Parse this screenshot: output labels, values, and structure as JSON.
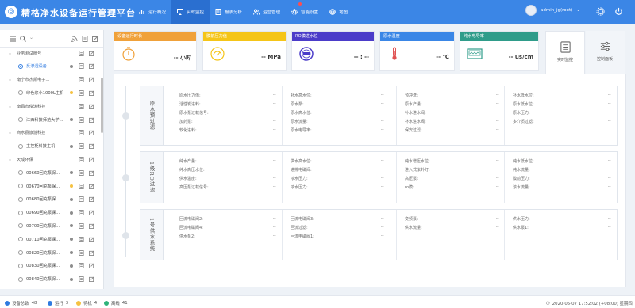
{
  "header": {
    "title": "精格净水设备运行管理平台",
    "nav": [
      {
        "label": "运行概况",
        "icon": "bar-chart-icon"
      },
      {
        "label": "实时监控",
        "icon": "monitor-icon",
        "active": true
      },
      {
        "label": "报表分析",
        "icon": "report-icon"
      },
      {
        "label": "运营管理",
        "icon": "users-icon"
      },
      {
        "label": "智能设置",
        "icon": "gear-icon",
        "badge": true
      },
      {
        "label": "地图",
        "icon": "globe-icon"
      }
    ],
    "user": "admin_jg(root)"
  },
  "sidebar": {
    "tree": [
      {
        "type": "group",
        "label": "业务测试账号"
      },
      {
        "type": "device",
        "label": "反渗透设备",
        "status": "gray",
        "selected": true
      },
      {
        "type": "group",
        "label": "南宁市杰凯电子..."
      },
      {
        "type": "device",
        "label": "印色浆小1000L主机",
        "status": "yellow"
      },
      {
        "type": "group",
        "label": "南昌市俊涛科技"
      },
      {
        "type": "device",
        "label": "江西科技师范大学...",
        "status": "gray"
      },
      {
        "type": "group",
        "label": "商水县旅游科技"
      },
      {
        "type": "device",
        "label": "主控柜科技主机",
        "status": "gray"
      },
      {
        "type": "group",
        "label": "天成环保"
      },
      {
        "type": "device",
        "label": "00660回充泵保...",
        "status": "gray"
      },
      {
        "type": "device",
        "label": "00670回充泵保...",
        "status": "yellow"
      },
      {
        "type": "device",
        "label": "00680回充泵保...",
        "status": "gray"
      },
      {
        "type": "device",
        "label": "00690回充泵保...",
        "status": "gray"
      },
      {
        "type": "device",
        "label": "00700回充泵保...",
        "status": "gray"
      },
      {
        "type": "device",
        "label": "00710回充泵保...",
        "status": "gray"
      },
      {
        "type": "device",
        "label": "00820回充泵保...",
        "status": "gray"
      },
      {
        "type": "device",
        "label": "00830回充泵保...",
        "status": "gray"
      },
      {
        "type": "device",
        "label": "00840回充泵保...",
        "status": "gray"
      }
    ]
  },
  "cards": [
    {
      "title": "设备运行时长",
      "value": "-- 小时",
      "color": "#f0a13a",
      "icon": "stopwatch-icon"
    },
    {
      "title": "膜前压力值",
      "value": "-- MPa",
      "color": "#f5c518",
      "icon": "pressure-gauge-icon"
    },
    {
      "title": "RO膜进水位",
      "value": "-- : --",
      "color": "#4b3cc9",
      "icon": "meter-icon"
    },
    {
      "title": "原水温度",
      "value": "-- ℃",
      "color": "#3a86e6",
      "icon": "thermometer-icon"
    },
    {
      "title": "纯水电导率",
      "value": "-- us/cm",
      "color": "#2f9c8a",
      "icon": "conductivity-icon"
    }
  ],
  "side_buttons": [
    {
      "label": "实时监控",
      "active": true
    },
    {
      "label": "控制面板",
      "active": false
    }
  ],
  "sections": [
    {
      "title": "原水预过滤",
      "columns": [
        [
          {
            "label": "原水压力值:",
            "value": "--"
          },
          {
            "label": "活性炭进料:",
            "value": "--"
          },
          {
            "label": "原水泵过载信号:",
            "value": "--"
          },
          {
            "label": "加药泵:",
            "value": "--"
          },
          {
            "label": "软化进料:",
            "value": "--"
          }
        ],
        [
          {
            "label": "补水高水位:",
            "value": "--"
          },
          {
            "label": "原水泵:",
            "value": "--"
          },
          {
            "label": "原水高水位:",
            "value": "--"
          },
          {
            "label": "原水流量:",
            "value": "--"
          },
          {
            "label": "原水电导率:",
            "value": "--"
          }
        ],
        [
          {
            "label": "预冲洗:",
            "value": "--"
          },
          {
            "label": "原水产量:",
            "value": "--"
          },
          {
            "label": "补水进水阀:",
            "value": "--"
          },
          {
            "label": "补水进水阀:",
            "value": "--"
          },
          {
            "label": "保安过滤:",
            "value": "--"
          }
        ],
        [
          {
            "label": "补水低水位:",
            "value": "--"
          },
          {
            "label": "原水低水位:",
            "value": "--"
          },
          {
            "label": "原水压力:",
            "value": "--"
          },
          {
            "label": "多介质过滤:",
            "value": "--"
          }
        ]
      ]
    },
    {
      "title": "1级RO过滤",
      "columns": [
        [
          {
            "label": "纯水产量:",
            "value": "--"
          },
          {
            "label": "纯水高压水位:",
            "value": "--"
          },
          {
            "label": "供水温度:",
            "value": "--"
          },
          {
            "label": "高压泵过载信号:",
            "value": "--"
          }
        ],
        [
          {
            "label": "供水高水位:",
            "value": "--"
          },
          {
            "label": "进排电磁阀:",
            "value": "--"
          },
          {
            "label": "浓水压力:",
            "value": "--"
          },
          {
            "label": "浓水压力:",
            "value": "--"
          }
        ],
        [
          {
            "label": "纯水增压水位:",
            "value": "--"
          },
          {
            "label": "进入式紫外灯:",
            "value": "--"
          },
          {
            "label": "高压泵:",
            "value": "--"
          },
          {
            "label": "ro膜:",
            "value": "--"
          }
        ],
        [
          {
            "label": "纯水低水位:",
            "value": "--"
          },
          {
            "label": "纯水流量:",
            "value": "--"
          },
          {
            "label": "膜前压力:",
            "value": "--"
          },
          {
            "label": "浓水流量:",
            "value": "--"
          }
        ]
      ]
    },
    {
      "title": "1号供水系统",
      "columns": [
        [
          {
            "label": "回流电磁阀2:",
            "value": "--"
          },
          {
            "label": "回流电磁阀4:",
            "value": "--"
          },
          {
            "label": "供水泵2:",
            "value": "--"
          }
        ],
        [
          {
            "label": "回流电磁阀3:",
            "value": "--"
          },
          {
            "label": "回流过滤:",
            "value": "--"
          },
          {
            "label": "回流电磁阀1:",
            "value": "--"
          }
        ],
        [
          {
            "label": "变频泵:",
            "value": "--"
          },
          {
            "label": "供水流量:",
            "value": "--"
          }
        ],
        [
          {
            "label": "供水压力:",
            "value": "--"
          },
          {
            "label": "供水泵1:",
            "value": "--"
          }
        ]
      ]
    }
  ],
  "statusbar": {
    "total_label": "设备总数",
    "total": "48",
    "running_label": "运行",
    "running": "3",
    "standby_label": "待机",
    "standby": "4",
    "offline_label": "离线",
    "offline": "41",
    "datetime": "2020-05-07 17:52:02 (+08:00) 星期四"
  },
  "colors": {
    "primary": "#3b86e6",
    "running": "#2f7be0",
    "standby": "#f5c242",
    "offline": "#2fb37a",
    "total": "#2f7be0"
  }
}
